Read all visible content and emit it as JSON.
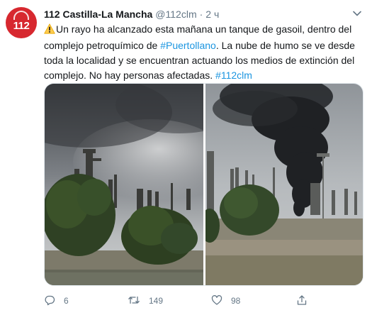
{
  "account": {
    "name": "112 Castilla-La Mancha",
    "handle": "@112clm",
    "separator": "·",
    "time": "2 ч",
    "avatar_text": "112",
    "avatar_color": "#d7282f"
  },
  "tweet": {
    "warning_icon": "warning-sign-icon",
    "text_part1": "Un rayo ha alcanzado esta mañana un tanque de gasoil, dentro del complejo petroquímico de ",
    "hashtag1": "#Puertollano",
    "text_part2": ". La nube de humo se ve desde toda la localidad y se encuentran actuando los medios de extinción del complejo. No hay personas afectadas. ",
    "hashtag2": "#112clm"
  },
  "media": {
    "photos": [
      "photo-refinery-smoke-left",
      "photo-refinery-smoke-right"
    ]
  },
  "actions": {
    "reply_count": "6",
    "retweet_count": "149",
    "like_count": "98",
    "share_icon": "share-icon"
  },
  "colors": {
    "text": "#14171a",
    "muted": "#657786",
    "link": "#1b95e0"
  }
}
